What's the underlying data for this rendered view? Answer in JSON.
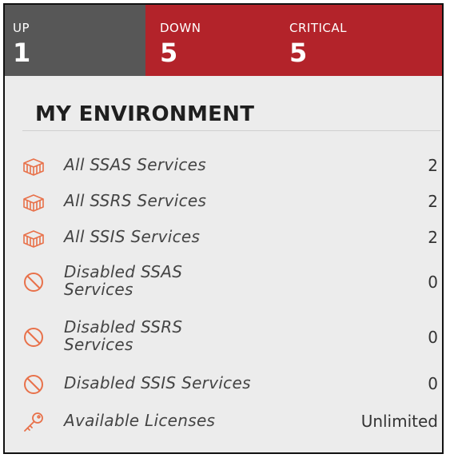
{
  "status": {
    "up": {
      "label": "UP",
      "count": "1"
    },
    "down": {
      "label": "DOWN",
      "count": "5"
    },
    "critical": {
      "label": "CRITICAL",
      "count": "5"
    }
  },
  "environment": {
    "title": "MY ENVIRONMENT",
    "items": [
      {
        "label": "All SSAS Services",
        "count": "2",
        "icon": "services-box-icon"
      },
      {
        "label": "All SSRS Services",
        "count": "2",
        "icon": "services-box-icon"
      },
      {
        "label": "All SSIS Services",
        "count": "2",
        "icon": "services-box-icon"
      },
      {
        "label": "Disabled SSAS Services",
        "count": "0",
        "icon": "disabled-circle-icon"
      },
      {
        "label": "Disabled SSRS Services",
        "count": "0",
        "icon": "disabled-circle-icon"
      },
      {
        "label": "Disabled SSIS Services",
        "count": "0",
        "icon": "disabled-circle-icon"
      },
      {
        "label": "Available Licenses",
        "count": "Unlimited",
        "icon": "key-icon"
      }
    ]
  },
  "colors": {
    "up": "#575757",
    "down": "#b3232a",
    "icon": "#e8714a"
  }
}
